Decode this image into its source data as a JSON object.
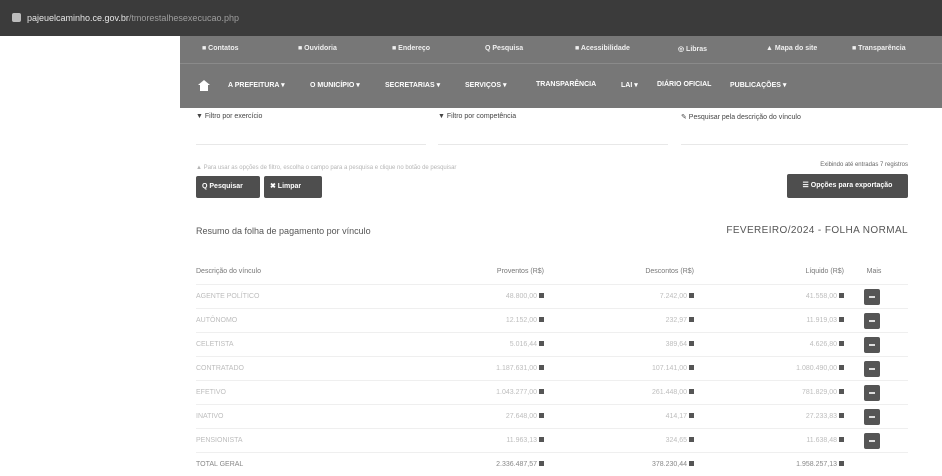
{
  "browser": {
    "url_main": "pajeuelcaminho.ce.gov.br",
    "url_path": "/tmorestalhesexecucao.php"
  },
  "topnav": [
    {
      "label": "■ Contatos"
    },
    {
      "label": "■ Ouvidoria"
    },
    {
      "label": "■ Endereço"
    },
    {
      "label": "Q Pesquisa"
    },
    {
      "label": "■ Acessibilidade"
    },
    {
      "label": "◎ Libras"
    },
    {
      "label": "▲ Mapa do site"
    },
    {
      "label": "■ Transparência"
    }
  ],
  "mainnav": [
    {
      "label": "A PREFEITURA ▾"
    },
    {
      "label": "O MUNICÍPIO ▾"
    },
    {
      "label": "SECRETARIAS ▾"
    },
    {
      "label": "SERVIÇOS ▾"
    },
    {
      "label": "TRANSPARÊNCIA"
    },
    {
      "label": "LAI ▾"
    },
    {
      "label": "DIÁRIO OFICIAL"
    },
    {
      "label": "PUBLICAÇÕES ▾"
    }
  ],
  "filters": {
    "exercise_label": "▼ Filtro por exercício",
    "competence_label": "▼ Filtro por competência",
    "search_label": "✎ Pesquisar pela descrição do vínculo",
    "hint": "▲ Para usar as opções de filtro, escolha o campo para a pesquisa e clique no botão de pesquisar"
  },
  "buttons": {
    "search": "Q Pesquisar",
    "clear": "✖ Limpar",
    "export": "☰ Opções para exportação"
  },
  "entries_text": "Exibindo até entradas 7 registros",
  "section_title": "Resumo da folha de pagamento por vínculo",
  "period": "FEVEREIRO/2024 - FOLHA NORMAL",
  "table": {
    "headers": [
      "Descrição do vínculo",
      "Proventos (R$)",
      "Descontos (R$)",
      "Líquido (R$)",
      "Mais"
    ],
    "rows": [
      {
        "name": "AGENTE POLÍTICO",
        "proventos": "48.800,00",
        "descontos": "7.242,00",
        "liquido": "41.558,00"
      },
      {
        "name": "AUTÔNOMO",
        "proventos": "12.152,00",
        "descontos": "232,97",
        "liquido": "11.919,03"
      },
      {
        "name": "CELETISTA",
        "proventos": "5.016,44",
        "descontos": "389,64",
        "liquido": "4.626,80"
      },
      {
        "name": "CONTRATADO",
        "proventos": "1.187.631,00",
        "descontos": "107.141,00",
        "liquido": "1.080.490,00"
      },
      {
        "name": "EFETIVO",
        "proventos": "1.043.277,00",
        "descontos": "261.448,00",
        "liquido": "781.829,00"
      },
      {
        "name": "INATIVO",
        "proventos": "27.648,00",
        "descontos": "414,17",
        "liquido": "27.233,83"
      },
      {
        "name": "PENSIONISTA",
        "proventos": "11.963,13",
        "descontos": "324,65",
        "liquido": "11.638,48"
      }
    ],
    "total": {
      "name": "TOTAL GERAL",
      "proventos": "2.336.487,57",
      "descontos": "378.230,44",
      "liquido": "1.958.257,13"
    }
  }
}
